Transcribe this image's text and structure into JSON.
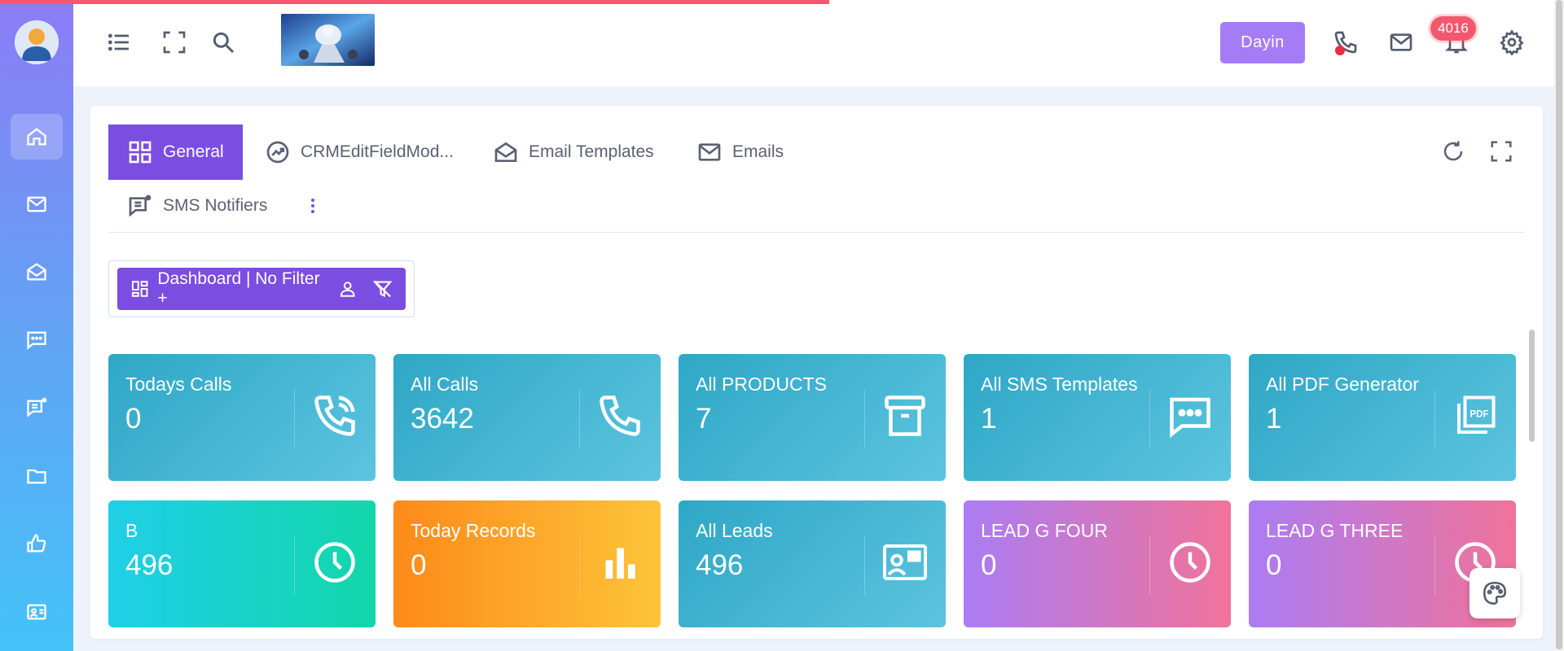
{
  "header": {
    "user_button": "Dayin",
    "notification_count": "4016",
    "progress_percent": 53
  },
  "sidebar": {
    "items": [
      "home-icon",
      "mail-icon",
      "mail-open-icon",
      "chat-icon",
      "notifier-icon",
      "folder-icon",
      "thumbs-up-icon",
      "contact-card-icon"
    ],
    "active": "home-icon"
  },
  "tabs": [
    {
      "label": "General",
      "active": true
    },
    {
      "label": "CRMEditFieldMod..."
    },
    {
      "label": "Email Templates"
    },
    {
      "label": "Emails"
    },
    {
      "label": "SMS Notifiers"
    }
  ],
  "filter": {
    "label": "Dashboard | No Filter +"
  },
  "tiles": [
    {
      "title": "Todays Calls",
      "value": "0",
      "icon": "phone-call-icon"
    },
    {
      "title": "All Calls",
      "value": "3642",
      "icon": "phone-icon"
    },
    {
      "title": "All PRODUCTS",
      "value": "7",
      "icon": "archive-icon"
    },
    {
      "title": "All SMS Templates",
      "value": "1",
      "icon": "sms-icon"
    },
    {
      "title": "All PDF Generator",
      "value": "1",
      "icon": "pdf-icon"
    },
    {
      "title": "B",
      "value": "496",
      "icon": "clock-icon"
    },
    {
      "title": "Today Records",
      "value": "0",
      "icon": "bar-chart-icon"
    },
    {
      "title": "All Leads",
      "value": "496",
      "icon": "contact-card-icon"
    },
    {
      "title": "LEAD G FOUR",
      "value": "0",
      "icon": "clock-icon"
    },
    {
      "title": "LEAD G THREE",
      "value": "0",
      "icon": "clock-icon"
    }
  ],
  "colors": {
    "accent": "#7b4de0",
    "badge": "#f5586e",
    "user_button": "#a57cf5"
  }
}
